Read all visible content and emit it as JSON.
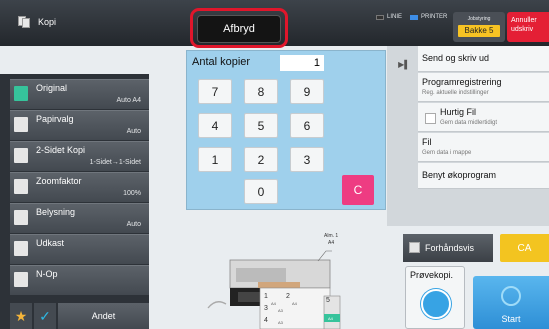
{
  "header": {
    "mode_label": "Kopi",
    "stop_label": "Afbryd",
    "indicator_line": "LINIE",
    "indicator_printer": "PRINTER",
    "job_status_label": "Jobstyring",
    "job_status_value": "Bakke 5",
    "cancel_print_label": "Annuller udskriv"
  },
  "copies": {
    "label": "Antal kopier",
    "value": "1",
    "keys": [
      "7",
      "8",
      "9",
      "4",
      "5",
      "6",
      "1",
      "2",
      "3",
      "0"
    ],
    "clear_label": "C"
  },
  "left_menu": [
    {
      "label": "Original",
      "value": "Auto   A4",
      "icon": "original-icon"
    },
    {
      "label": "Papirvalg",
      "value": "Auto",
      "icon": "paper-icon"
    },
    {
      "label": "2-Sidet Kopi",
      "value": "1-Sidet→1-Sidet",
      "icon": "duplex-icon"
    },
    {
      "label": "Zoomfaktor",
      "value": "100%",
      "icon": "zoom-icon"
    },
    {
      "label": "Belysning",
      "value": "Auto",
      "icon": "exposure-icon"
    },
    {
      "label": "Udkast",
      "value": "",
      "icon": "draft-icon"
    },
    {
      "label": "N-Op",
      "value": "",
      "icon": "n-up-icon"
    }
  ],
  "bottom_left": {
    "favorites_icon": "star-icon",
    "check_icon": "checkmark-icon",
    "other_label": "Andet"
  },
  "right_menu": {
    "send_print": "Send og skriv ud",
    "program_reg": "Programregistrering",
    "program_reg_sub": "Reg. aktuelle indstillinger",
    "quick_file": "Hurtig Fil",
    "quick_file_sub": "Gem data midlertidigt",
    "file": "Fil",
    "file_sub": "Gem data i mappe",
    "eco": "Benyt økoprogram"
  },
  "machine": {
    "tray_label_line1": "Alm. 1",
    "tray_label_line2": "A4",
    "tray_labels": [
      "1",
      "2",
      "3",
      "4",
      "5"
    ],
    "tray_sizes": [
      "A4",
      "A4",
      "A3",
      "A3",
      "A4"
    ]
  },
  "actions": {
    "preview_label": "Forhåndsvis",
    "ca_label": "CA",
    "proof_copy_label": "Prøvekopi.",
    "start_label": "Start"
  },
  "colors": {
    "accent_blue": "#37a3e4",
    "stop_ring": "#e0162b",
    "keypad_bg": "#9fd0ec",
    "clear_key": "#ee3c82",
    "ca_button": "#f3c420",
    "job_box": "#f7c323"
  }
}
